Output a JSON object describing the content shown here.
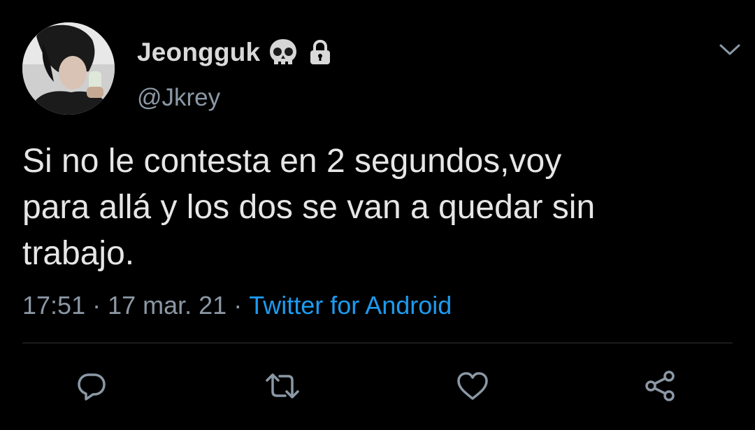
{
  "tweet": {
    "display_name": "Jeongguk",
    "handle": "@Jkrey",
    "text": "Si no le contesta en 2 segundos,voy\npara allá y los dos se van a quedar sin\ntrabajo.",
    "time": "17:51",
    "separator": "·",
    "date": "17 mar. 21",
    "source": "Twitter for Android"
  },
  "icons": {
    "name_badges": [
      "skull-icon",
      "lock-icon"
    ],
    "menu": "chevron-down-icon",
    "actions": [
      "reply-icon",
      "retweet-icon",
      "like-icon",
      "share-icon"
    ]
  },
  "colors": {
    "background": "#000000",
    "text": "#e6e6e6",
    "secondary": "#8b98a5",
    "link": "#1d9bf0",
    "divider": "#2f3336"
  }
}
